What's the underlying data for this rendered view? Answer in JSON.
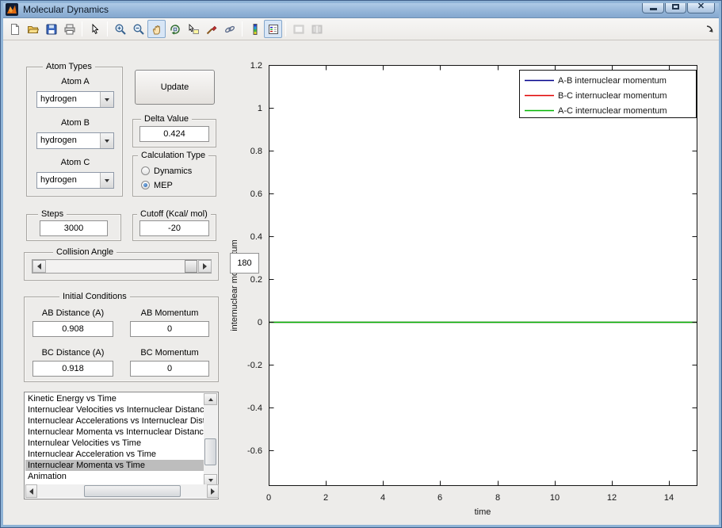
{
  "window": {
    "title": "Molecular Dynamics",
    "buttons": [
      "minimize",
      "maximize",
      "close"
    ]
  },
  "toolbar": {
    "items": [
      {
        "name": "new-figure",
        "state": "normal"
      },
      {
        "name": "open-file",
        "state": "normal"
      },
      {
        "name": "save-figure",
        "state": "normal"
      },
      {
        "name": "print-figure",
        "state": "normal"
      },
      {
        "name": "edit-plot",
        "state": "normal"
      },
      {
        "name": "zoom-in",
        "state": "normal"
      },
      {
        "name": "zoom-out",
        "state": "normal"
      },
      {
        "name": "pan",
        "state": "active"
      },
      {
        "name": "rotate-3d",
        "state": "normal"
      },
      {
        "name": "data-cursor",
        "state": "normal"
      },
      {
        "name": "brush-data",
        "state": "normal"
      },
      {
        "name": "link-plot",
        "state": "normal"
      },
      {
        "name": "insert-colorbar",
        "state": "normal"
      },
      {
        "name": "insert-legend",
        "state": "active"
      },
      {
        "name": "hide-plot-tools",
        "state": "disabled"
      },
      {
        "name": "show-plot-tools",
        "state": "disabled"
      },
      {
        "name": "dock-figure",
        "state": "normal"
      }
    ]
  },
  "controls": {
    "atom_types": {
      "title": "Atom Types",
      "atom_a_label": "Atom A",
      "atom_a_value": "hydrogen",
      "atom_b_label": "Atom B",
      "atom_b_value": "hydrogen",
      "atom_c_label": "Atom C",
      "atom_c_value": "hydrogen"
    },
    "update_button": {
      "label": "Update"
    },
    "delta": {
      "title": "Delta Value",
      "value": "0.424"
    },
    "calculation_type": {
      "title": "Calculation Type",
      "options": [
        {
          "label": "Dynamics",
          "selected": false
        },
        {
          "label": "MEP",
          "selected": true
        }
      ]
    },
    "steps": {
      "title": "Steps",
      "value": "3000"
    },
    "cutoff": {
      "title": "Cutoff (Kcal/ mol)",
      "value": "-20"
    },
    "collision_angle": {
      "title": "Collision Angle",
      "value": "180"
    },
    "initial_conditions": {
      "title": "Initial Conditions",
      "ab_distance_label": "AB Distance (A)",
      "ab_distance_value": "0.908",
      "ab_momentum_label": "AB Momentum",
      "ab_momentum_value": "0",
      "bc_distance_label": "BC Distance (A)",
      "bc_distance_value": "0.918",
      "bc_momentum_label": "BC Momentum",
      "bc_momentum_value": "0"
    },
    "plot_list": {
      "items": [
        "Kinetic Energy vs Time",
        "Internuclear Velocities vs Internuclear Distance",
        "Internuclear Accelerations vs Internuclear Distance",
        "Internuclear Momenta vs Internuclear Distance",
        "Internulear Velocities vs Time",
        "Internuclear Acceleration vs Time",
        "Internuclear Momenta vs Time",
        "Animation"
      ],
      "selected_index": 6
    }
  },
  "chart_data": {
    "type": "line",
    "title": "",
    "xlabel": "time",
    "ylabel": "internuclear momentum",
    "xlim": [
      0,
      15
    ],
    "ylim": [
      -0.77,
      1.2
    ],
    "grid": false,
    "box": true,
    "xticks": [
      0,
      2,
      4,
      6,
      8,
      10,
      12,
      14
    ],
    "yticks": [
      1.2,
      1,
      0.8,
      0.6,
      0.4,
      0.2,
      0,
      -0.2,
      -0.4,
      -0.6
    ],
    "xtick_labels": [
      "0",
      "2",
      "4",
      "6",
      "8",
      "10",
      "12",
      "14"
    ],
    "ytick_labels": [
      "1.2",
      "1",
      "0.8",
      "0.6",
      "0.4",
      "0.2",
      "0",
      "-0.2",
      "-0.4",
      "-0.6"
    ],
    "legend": {
      "position": "northeast",
      "entries": [
        {
          "label": "A-B internuclear momentum",
          "color": "#00008b"
        },
        {
          "label": "B-C internuclear momentum",
          "color": "#e00000"
        },
        {
          "label": "A-C internuclear momentum",
          "color": "#00b400"
        }
      ]
    },
    "series": [
      {
        "name": "A-B internuclear momentum",
        "color": "#00008b",
        "x": [
          0,
          15
        ],
        "y": [
          0,
          0
        ]
      },
      {
        "name": "B-C internuclear momentum",
        "color": "#e00000",
        "x": [
          0,
          15
        ],
        "y": [
          0,
          0
        ]
      },
      {
        "name": "A-C internuclear momentum",
        "color": "#00b400",
        "x": [
          0,
          15
        ],
        "y": [
          0,
          0
        ]
      }
    ]
  }
}
